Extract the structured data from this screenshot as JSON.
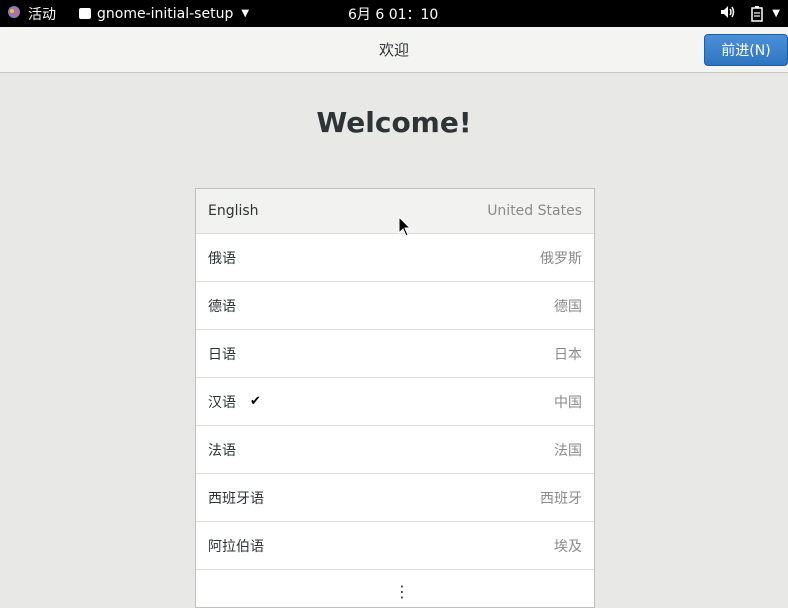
{
  "topbar": {
    "activities_label": "活动",
    "app_name": "gnome-initial-setup",
    "clock": "6月 6 01：10"
  },
  "header": {
    "title": "欢迎",
    "next_label": "前进(N)"
  },
  "main": {
    "title": "Welcome!",
    "languages": [
      {
        "name": "English",
        "region": "United States"
      },
      {
        "name": "俄语",
        "region": "俄罗斯"
      },
      {
        "name": "德语",
        "region": "德国"
      },
      {
        "name": "日语",
        "region": "日本"
      },
      {
        "name": "汉语",
        "region": "中国",
        "selected": true
      },
      {
        "name": "法语",
        "region": "法国"
      },
      {
        "name": "西班牙语",
        "region": "西班牙"
      },
      {
        "name": "阿拉伯语",
        "region": "埃及"
      }
    ]
  },
  "icons": {
    "activities": "gnome-foot-icon",
    "volume": "speaker-icon",
    "battery": "battery-icon",
    "selected": "check-icon",
    "more": "vertical-ellipsis-icon"
  }
}
